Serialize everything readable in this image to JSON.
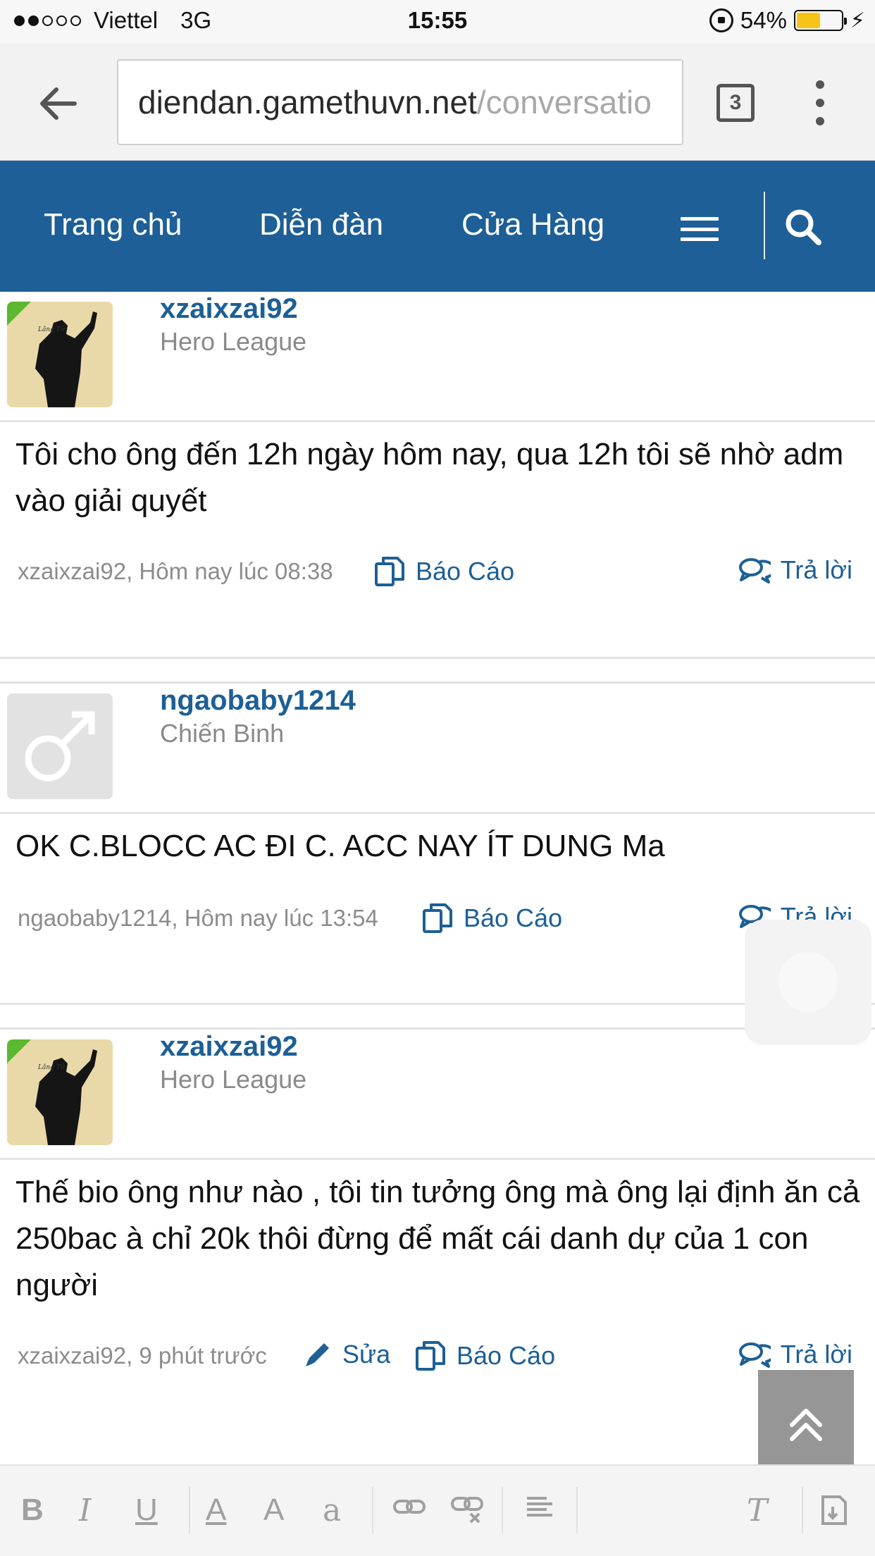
{
  "status_bar": {
    "carrier": "Viettel",
    "network": "3G",
    "time": "15:55",
    "battery": "54%",
    "battery_level": 0.54,
    "signal_filled": 2,
    "signal_total": 5
  },
  "browser": {
    "url_host": "diendan.gamethuvn.net",
    "url_path": "/conversatio",
    "tab_count": "3"
  },
  "nav": {
    "home": "Trang chủ",
    "forum": "Diễn đàn",
    "shop": "Cửa Hàng"
  },
  "messages": [
    {
      "username": "xzaixzai92",
      "user_title": "Hero League",
      "text": "Tôi cho ông đến 12h ngày hôm nay, qua 12h tôi sẽ nhờ adm vào giải quyết",
      "meta": "xzaixzai92, Hôm nay lúc 08:38",
      "report": "Báo Cáo",
      "reply": "Trả lời"
    },
    {
      "username": "ngaobaby1214",
      "user_title": "Chiến Binh",
      "text": "OK C.BLOCC AC ĐI C. ACC NAY ÍT DUNG Ma",
      "meta": "ngaobaby1214, Hôm nay lúc 13:54",
      "report": "Báo Cáo",
      "reply": "Trả lời"
    },
    {
      "username": "xzaixzai92",
      "user_title": "Hero League",
      "text": "Thế bio ông như nào , tôi tin tưởng ông mà ông lại định ăn cả 250bac à chỉ 20k thôi đừng để mất cái danh dự của 1 con người",
      "meta": "xzaixzai92, 9 phút trước",
      "edit": "Sửa",
      "report": "Báo Cáo",
      "reply": "Trả lời"
    }
  ],
  "avatar_caption": "Lãng Tử",
  "editor_tools": {
    "bold": "B",
    "italic": "I",
    "underline": "U",
    "color": "A",
    "size": "A",
    "font": "a",
    "clear": "T"
  },
  "colors": {
    "brand_blue": "#1d5f96",
    "status_bar": "#f7f7f7",
    "meta_grey": "#8c8c8c"
  }
}
